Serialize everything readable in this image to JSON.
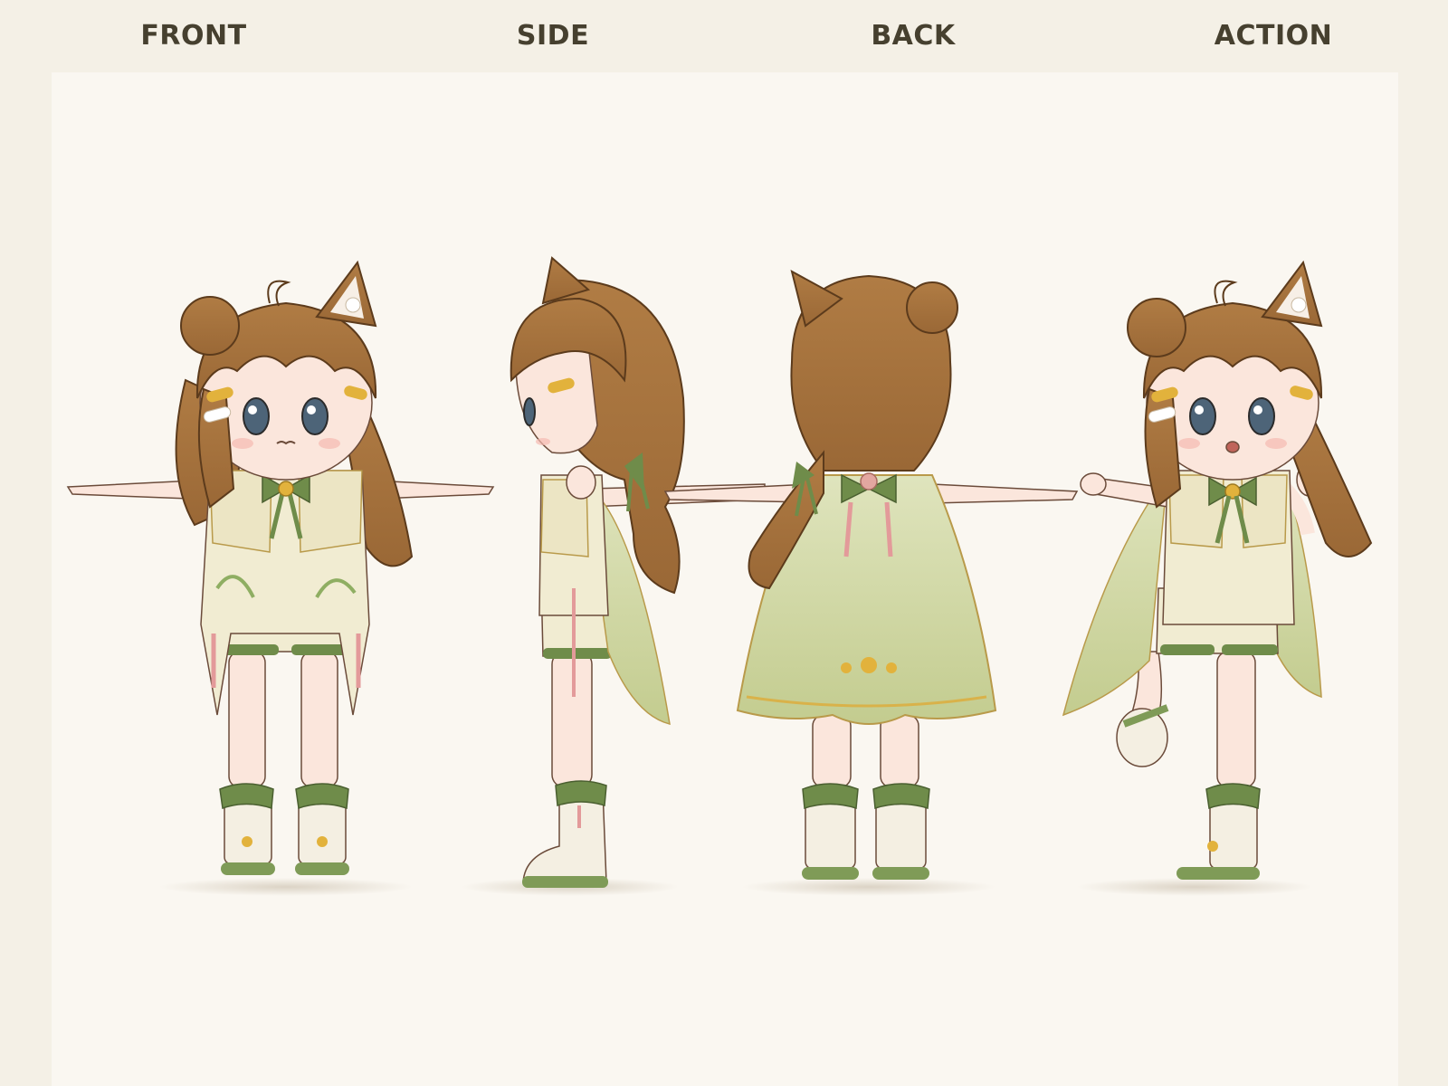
{
  "views": [
    {
      "id": "front",
      "label": "FRONT"
    },
    {
      "id": "side",
      "label": "SIDE"
    },
    {
      "id": "back",
      "label": "BACK"
    },
    {
      "id": "action",
      "label": "ACTION"
    }
  ],
  "colors": {
    "page_bg": "#f4f0e6",
    "canvas_bg": "#faf7f1",
    "label_text": "#46402f",
    "hair": "#a8743e",
    "hair_dark": "#7a4f26",
    "skin": "#fbe6dc",
    "robe": "#f1ecd2",
    "cape": "#c9d39a",
    "ribbon_green": "#6f8c4a",
    "gold": "#e2b23c",
    "tassel_pink": "#e39a9a",
    "eye": "#4d6478",
    "shoe": "#f4efe2"
  }
}
